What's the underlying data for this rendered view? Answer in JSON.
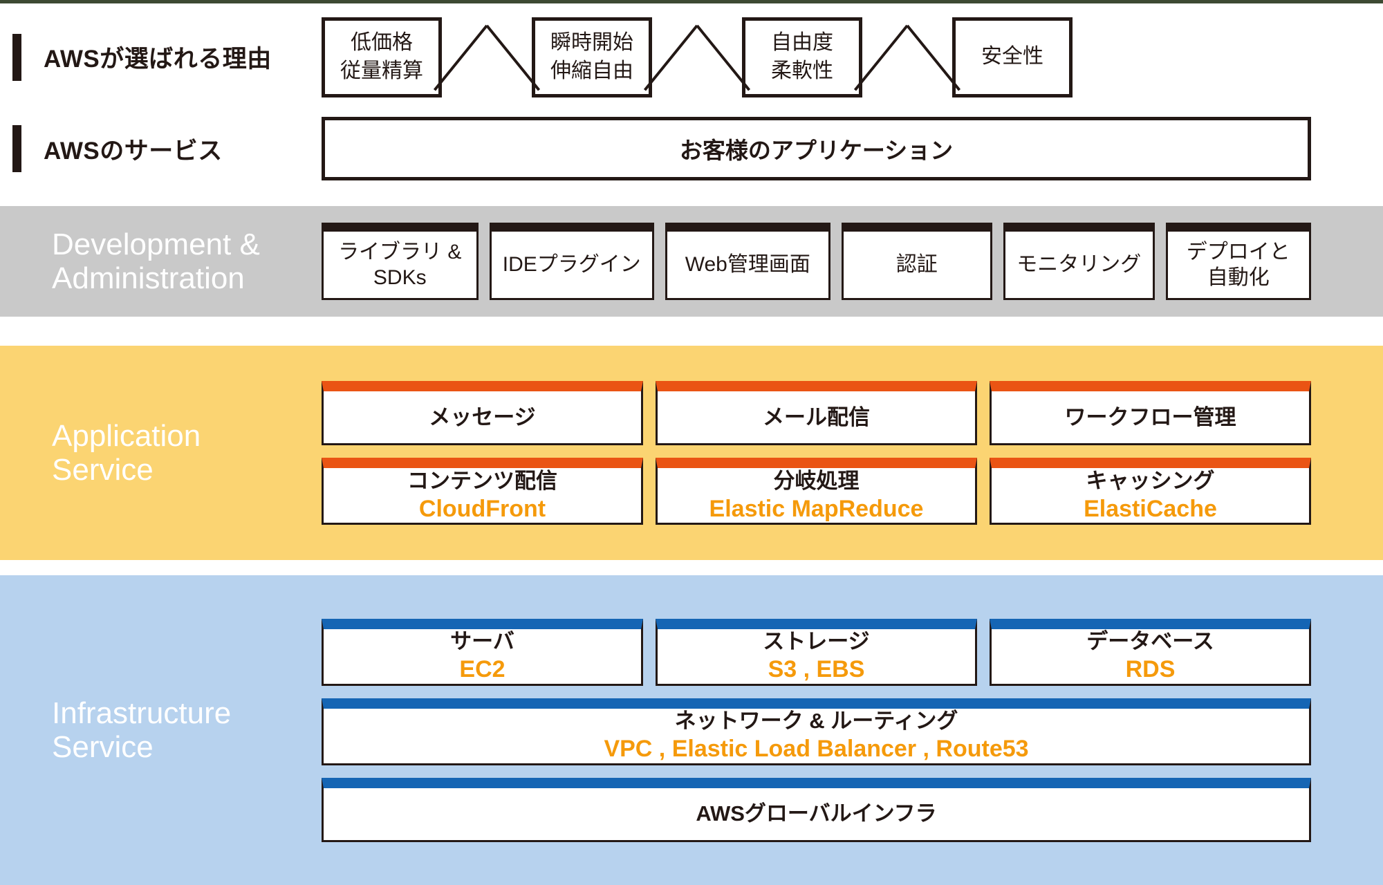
{
  "accents": {
    "top_rule": "#3d4a33",
    "ink": "#231815",
    "gray_band": "#c9c9c9",
    "amber_band": "#fbd472",
    "blue_band": "#b7d2ee",
    "orange_accent": "#ea5414",
    "blue_accent": "#1565b4",
    "service_name_orange": "#f59a0b"
  },
  "rows": {
    "reasons": {
      "label": "AWSが選ばれる理由",
      "boxes": [
        {
          "text": "低価格\n従量精算"
        },
        {
          "text": "瞬時開始\n伸縮自由"
        },
        {
          "text": "自由度\n柔軟性"
        },
        {
          "text": "安全性"
        }
      ],
      "separator_icon": "cross-icon"
    },
    "aws_services": {
      "label": "AWSのサービス",
      "box": {
        "text": "お客様のアプリケーション"
      }
    }
  },
  "dev_admin": {
    "title": "Development &\nAdministration",
    "boxes": [
      {
        "text": "ライブラリ &\nSDKs"
      },
      {
        "text": "IDEプラグイン"
      },
      {
        "text": "Web管理画面"
      },
      {
        "text": "認証"
      },
      {
        "text": "モニタリング"
      },
      {
        "text": "デプロイと\n自動化"
      }
    ]
  },
  "application_service": {
    "title": "Application\nService",
    "row1": [
      {
        "jp": "メッセージ",
        "en": ""
      },
      {
        "jp": "メール配信",
        "en": ""
      },
      {
        "jp": "ワークフロー管理",
        "en": ""
      }
    ],
    "row2": [
      {
        "jp": "コンテンツ配信",
        "en": "CloudFront"
      },
      {
        "jp": "分岐処理",
        "en": "Elastic MapReduce"
      },
      {
        "jp": "キャッシング",
        "en": "ElastiCache"
      }
    ]
  },
  "infrastructure_service": {
    "title": "Infrastructure\nService",
    "row1": [
      {
        "jp": "サーバ",
        "en": "EC2"
      },
      {
        "jp": "ストレージ",
        "en": "S3 , EBS"
      },
      {
        "jp": "データベース",
        "en": "RDS"
      }
    ],
    "row2": [
      {
        "jp": "ネットワーク & ルーティング",
        "en": "VPC , Elastic Load Balancer , Route53"
      }
    ],
    "row3": [
      {
        "jp": "AWSグローバルインフラ",
        "en": ""
      }
    ]
  }
}
